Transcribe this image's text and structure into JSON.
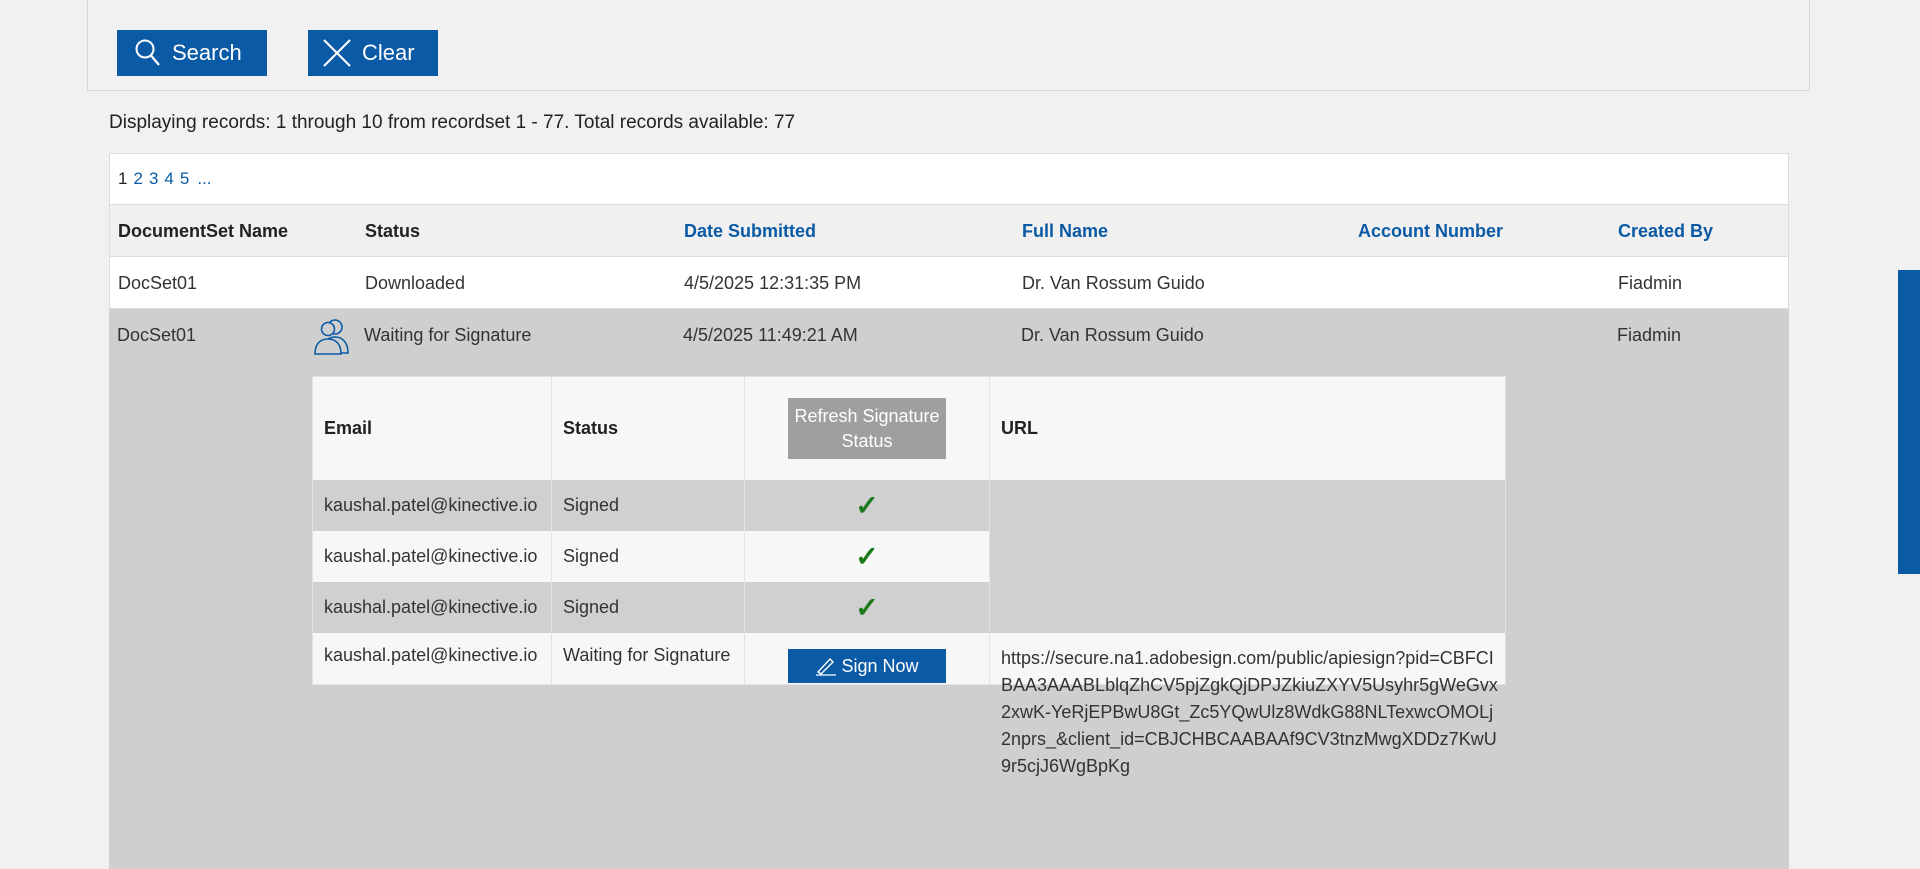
{
  "toolbar": {
    "search_label": "Search",
    "clear_label": "Clear"
  },
  "records_info": "Displaying records: 1 through 10 from recordset 1 - 77. Total records available: 77",
  "pager": {
    "current": "1",
    "pages": [
      "2",
      "3",
      "4",
      "5"
    ],
    "more": "..."
  },
  "columns": {
    "docset": "DocumentSet Name",
    "status": "Status",
    "date": "Date Submitted",
    "name": "Full Name",
    "account": "Account Number",
    "created": "Created By"
  },
  "rows": [
    {
      "docset": "DocSet01",
      "status": "Downloaded",
      "date": "4/5/2025 12:31:35 PM",
      "name": "Dr. Van Rossum Guido",
      "account": "",
      "created": "Fiadmin"
    },
    {
      "docset": "DocSet01",
      "status": "Waiting for Signature",
      "date": "4/5/2025 11:49:21 AM",
      "name": "Dr. Van Rossum Guido",
      "account": "",
      "created": "Fiadmin"
    }
  ],
  "signers": {
    "headers": {
      "email": "Email",
      "status": "Status",
      "url": "URL"
    },
    "refresh_label": "Refresh Signature Status",
    "sign_now_label": "Sign Now",
    "rows": [
      {
        "email": "kaushal.patel@kinective.io",
        "status": "Signed",
        "url": ""
      },
      {
        "email": "kaushal.patel@kinective.io",
        "status": "Signed",
        "url": ""
      },
      {
        "email": "kaushal.patel@kinective.io",
        "status": "Signed",
        "url": ""
      },
      {
        "email": "kaushal.patel@kinective.io",
        "status": "Waiting for Signature",
        "url": "https://secure.na1.adobesign.com/public/apiesign?pid=CBFCIBAA3AAABLblqZhCV5pjZgkQjDPJZkiuZXYV5Usyhr5gWeGvx2xwK-YeRjEPBwU8Gt_Zc5YQwUlz8WdkG88NLTexwcOMOLj2nprs_&client_id=CBJCHBCAABAAf9CV3tnzMwgXDDz7KwU9r5cjJ6WgBpKg"
      }
    ]
  },
  "icons": {
    "check": "✓"
  },
  "colors": {
    "primary": "#0a5aa5",
    "signed_check": "#1c7a1c",
    "row_highlight": "#cfcfcf"
  }
}
